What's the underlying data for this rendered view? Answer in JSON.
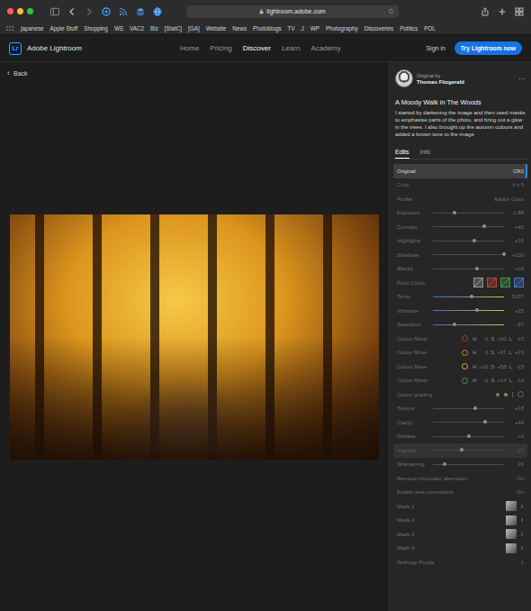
{
  "browser": {
    "address": "lightroom.adobe.com",
    "bookmarks": [
      "japanese",
      "Apple Stuff",
      "Shopping",
      "WS",
      "VAC2",
      "Biz",
      "[StatC]",
      "[GA]",
      "Website",
      "News",
      "Photoblogs",
      "TV",
      "J",
      "WP",
      "Photography",
      "Discoveries",
      "Politics",
      "POL"
    ]
  },
  "header": {
    "logo": "Lr",
    "product": "Adobe Lightroom",
    "nav": [
      {
        "label": "Home",
        "selected": false
      },
      {
        "label": "Pricing",
        "selected": false
      },
      {
        "label": "Discover",
        "selected": true
      },
      {
        "label": "Learn",
        "selected": false
      },
      {
        "label": "Academy",
        "selected": false
      }
    ],
    "sign_in": "Sign in",
    "cta": "Try Lightroom now"
  },
  "back": {
    "icon": "‹",
    "label": "Back"
  },
  "author": {
    "caption": "Original by",
    "name": "Thomas Fitzgerald",
    "more": "···"
  },
  "title": "A Moody Walk in The Woods",
  "description": "I started by darkening the image and then used masks to emphasise parts of the photo, and bring out a glow in the trees. I also brought up the autumn colours and added a brown tone to the image",
  "tabs": [
    {
      "label": "Edits",
      "selected": true
    },
    {
      "label": "Info",
      "selected": false
    }
  ],
  "edits": [
    {
      "kind": "value",
      "label": "Original",
      "value": "CR2",
      "selected": true,
      "hovered": false
    },
    {
      "kind": "value",
      "label": "Crop",
      "value": "4 x 5",
      "selected": false,
      "hovered": false
    },
    {
      "kind": "value",
      "label": "Profile",
      "value": "Adobe Color",
      "selected": false,
      "hovered": false
    },
    {
      "kind": "slider",
      "label": "Exposure",
      "level": 0.31,
      "reading": "-1.88",
      "selected": false,
      "hovered": false
    },
    {
      "kind": "slider",
      "label": "Contrast",
      "level": 0.72,
      "reading": "+45",
      "selected": false,
      "hovered": false
    },
    {
      "kind": "slider",
      "label": "Highlights",
      "level": 0.58,
      "reading": "+16",
      "selected": false,
      "hovered": false
    },
    {
      "kind": "slider",
      "label": "Shadows",
      "level": 1.0,
      "reading": "+100",
      "selected": false,
      "hovered": false
    },
    {
      "kind": "slider",
      "label": "Blacks",
      "level": 0.62,
      "reading": "+24",
      "selected": false,
      "hovered": false
    },
    {
      "kind": "curve",
      "label": "Point Curve",
      "channels": [
        {
          "color": "#9a9a9a"
        },
        {
          "color": "#c0413e"
        },
        {
          "color": "#3f9a4a"
        },
        {
          "color": "#4a74c8"
        }
      ],
      "selected": false,
      "hovered": false
    },
    {
      "kind": "tinted-slider",
      "label": "Temp",
      "level": 0.55,
      "reading": "5237",
      "selected": false,
      "hovered": false
    },
    {
      "kind": "tinted-slider",
      "label": "Vibrance",
      "level": 0.62,
      "reading": "+25",
      "selected": false,
      "hovered": false
    },
    {
      "kind": "tinted-slider",
      "label": "Saturation",
      "level": 0.31,
      "reading": "-37",
      "selected": false,
      "hovered": false
    },
    {
      "kind": "mixer",
      "label": "Colour Mixer",
      "color": "#c0392b",
      "values": [
        {
          "letter": "H",
          "value": "0"
        },
        {
          "letter": "S",
          "value": "+50"
        },
        {
          "letter": "L",
          "value": "-15"
        }
      ],
      "selected": false,
      "hovered": false
    },
    {
      "kind": "mixer",
      "label": "Colour Mixer",
      "color": "#d9822b",
      "values": [
        {
          "letter": "H",
          "value": "0"
        },
        {
          "letter": "S",
          "value": "+67"
        },
        {
          "letter": "L",
          "value": "+23"
        }
      ],
      "selected": false,
      "hovered": false
    },
    {
      "kind": "mixer",
      "label": "Colour Mixer",
      "color": "#d4b82a",
      "values": [
        {
          "letter": "H",
          "value": "+10"
        },
        {
          "letter": "S",
          "value": "+58"
        },
        {
          "letter": "L",
          "value": "-15"
        }
      ],
      "selected": false,
      "hovered": false
    },
    {
      "kind": "mixer",
      "label": "Colour Mixer",
      "color": "#3f9a4a",
      "values": [
        {
          "letter": "H",
          "value": "-1"
        },
        {
          "letter": "S",
          "value": "+14"
        },
        {
          "letter": "L",
          "value": "-12"
        }
      ],
      "selected": false,
      "hovered": false
    },
    {
      "kind": "grading",
      "label": "Colour grading",
      "selected": false,
      "hovered": false
    },
    {
      "kind": "slider",
      "label": "Texture",
      "level": 0.59,
      "reading": "+18",
      "selected": false,
      "hovered": false
    },
    {
      "kind": "slider",
      "label": "Clarity",
      "level": 0.74,
      "reading": "+49",
      "selected": false,
      "hovered": false
    },
    {
      "kind": "slider",
      "label": "Dehaze",
      "level": 0.51,
      "reading": "+2",
      "selected": false,
      "hovered": false
    },
    {
      "kind": "slider",
      "label": "Vignette",
      "level": 0.41,
      "reading": "-17",
      "selected": false,
      "hovered": true
    },
    {
      "kind": "slider",
      "label": "Sharpening",
      "level": 0.17,
      "reading": "26",
      "selected": false,
      "hovered": false
    },
    {
      "kind": "value",
      "label": "Remove chromatic aberration",
      "value": "On",
      "selected": false,
      "hovered": false
    },
    {
      "kind": "value",
      "label": "Enable lens corrections",
      "value": "On",
      "selected": false,
      "hovered": false
    },
    {
      "kind": "mask",
      "label": "Mask 1",
      "selected": false,
      "hovered": false
    },
    {
      "kind": "mask",
      "label": "Mask 2",
      "selected": false,
      "hovered": false
    },
    {
      "kind": "mask",
      "label": "Mask 3",
      "selected": false,
      "hovered": false
    },
    {
      "kind": "mask",
      "label": "Mask 4",
      "selected": false,
      "hovered": false
    },
    {
      "kind": "value",
      "label": "Defringe Purple",
      "value": "1",
      "selected": false,
      "hovered": false
    }
  ]
}
